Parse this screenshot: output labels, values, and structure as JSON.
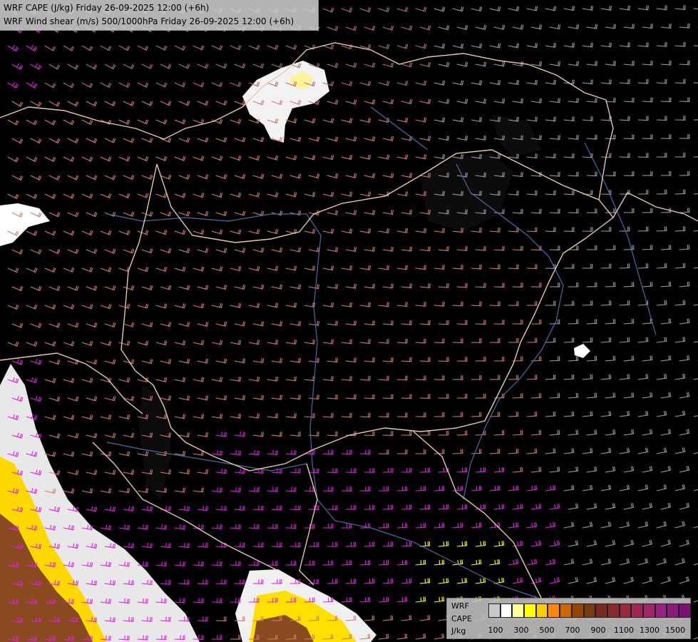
{
  "header": {
    "line1": "WRF CAPE (J/kg) Friday 26-09-2025 12:00 (+6h)",
    "line2": "WRF Wind shear (m/s) 500/1000hPa Friday 26-09-2025 12:00 (+6h)"
  },
  "legend": {
    "label_model": "WRF",
    "label_field": "CAPE",
    "label_unit": "J/kg",
    "colors": [
      "#c8c8c8",
      "#ffffff",
      "#ffff99",
      "#ffff00",
      "#ffcc00",
      "#ff8800",
      "#cc6600",
      "#994400",
      "#7a3a10",
      "#7a2a20",
      "#8b2a2a",
      "#992a3a",
      "#a02850",
      "#a0286a",
      "#9a2080",
      "#8a1a7a",
      "#7a1070"
    ],
    "ticks": [
      "100",
      "300",
      "500",
      "700",
      "900",
      "1100",
      "1300",
      "1500"
    ]
  },
  "map": {
    "background": "#000000",
    "barb_colors": {
      "weak": "#9a9aa4",
      "moderate": "#b07070",
      "strong": "#d07a70",
      "very_strong": "#e020e0",
      "extreme": "#ffff00"
    },
    "border_color": "#e8c8a8",
    "river_color": "#4a6aa8",
    "cape_light_color": "#ffffff",
    "cape_medium_color": "#ffee00",
    "cape_high_color": "#8a4a20"
  }
}
